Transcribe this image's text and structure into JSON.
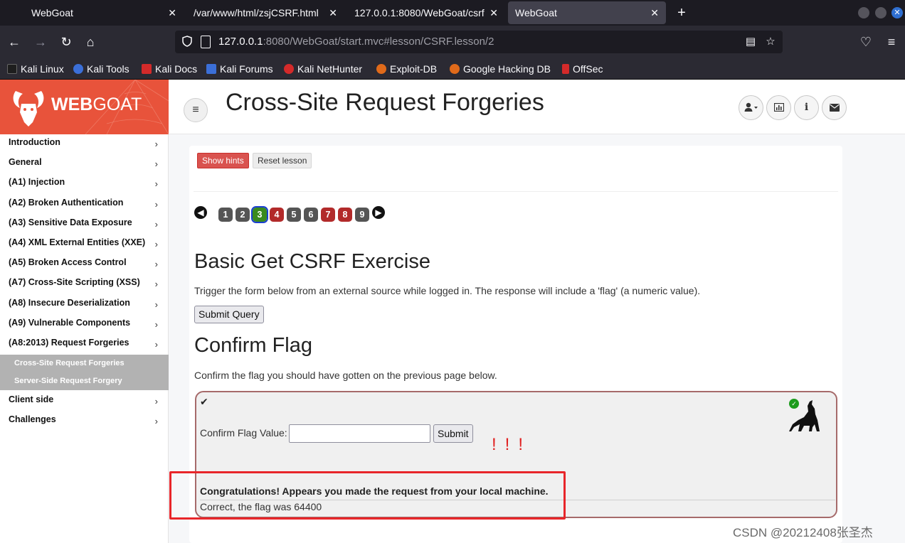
{
  "browser": {
    "tabs": [
      {
        "title": "WebGoat",
        "active": false
      },
      {
        "title": "/var/www/html/zsjCSRF.html",
        "active": false
      },
      {
        "title": "127.0.0.1:8080/WebGoat/csrf",
        "active": false
      },
      {
        "title": "WebGoat",
        "active": true
      }
    ],
    "tab_close": "✕",
    "new_tab": "+",
    "url": {
      "host": "127.0.0.1",
      "rest": ":8080/WebGoat/start.mvc#lesson/CSRF.lesson/2"
    },
    "bookmarks": [
      {
        "label": "Kali Linux",
        "color": "#1e1e1e"
      },
      {
        "label": "Kali Tools",
        "color": "#3b6fd8"
      },
      {
        "label": "Kali Docs",
        "color": "#d42a2a"
      },
      {
        "label": "Kali Forums",
        "color": "#3b6fd8"
      },
      {
        "label": "Kali NetHunter",
        "color": "#d42a2a"
      },
      {
        "label": "Exploit-DB",
        "color": "#e06a1a"
      },
      {
        "label": "Google Hacking DB",
        "color": "#e06a1a"
      },
      {
        "label": "OffSec",
        "color": "#d42a2a"
      }
    ]
  },
  "brand": {
    "bold": "WEB",
    "light": "GOAT",
    "color": "#e8533b"
  },
  "sidebar": {
    "items_top": [
      "Introduction",
      "General",
      "(A1) Injection",
      "(A2) Broken Authentication",
      "(A3) Sensitive Data Exposure",
      "(A4) XML External Entities (XXE)",
      "(A5) Broken Access Control",
      "(A7) Cross-Site Scripting (XSS)",
      "(A8) Insecure Deserialization",
      "(A9) Vulnerable Components",
      "(A8:2013) Request Forgeries"
    ],
    "sub_items": [
      "Cross-Site Request Forgeries",
      "Server-Side Request Forgery"
    ],
    "items_bottom": [
      "Client side",
      "Challenges"
    ],
    "chevron": "›"
  },
  "header": {
    "title": "Cross-Site Request Forgeries"
  },
  "lesson": {
    "show_hints": "Show hints",
    "reset_lesson": "Reset lesson",
    "pages": [
      {
        "n": "1",
        "state": "done"
      },
      {
        "n": "2",
        "state": "done"
      },
      {
        "n": "3",
        "state": "current"
      },
      {
        "n": "4",
        "state": "todo"
      },
      {
        "n": "5",
        "state": "done"
      },
      {
        "n": "6",
        "state": "done"
      },
      {
        "n": "7",
        "state": "todo"
      },
      {
        "n": "8",
        "state": "todo"
      },
      {
        "n": "9",
        "state": "done"
      }
    ],
    "exercise_title": "Basic Get CSRF Exercise",
    "exercise_text": "Trigger the form below from an external source while logged in. The response will include a 'flag' (a numeric value).",
    "submit_query": "Submit Query",
    "confirm_title": "Confirm Flag",
    "confirm_text": "Confirm the flag you should have gotten on the previous page below.",
    "flag_label": "Confirm Flag Value:",
    "flag_value": "",
    "submit": "Submit",
    "annotation_marks": "!!!",
    "congrats": "Congratulations! Appears you made the request from your local machine.",
    "result": "Correct, the flag was 64400"
  },
  "watermark": "CSDN @20212408张圣杰"
}
